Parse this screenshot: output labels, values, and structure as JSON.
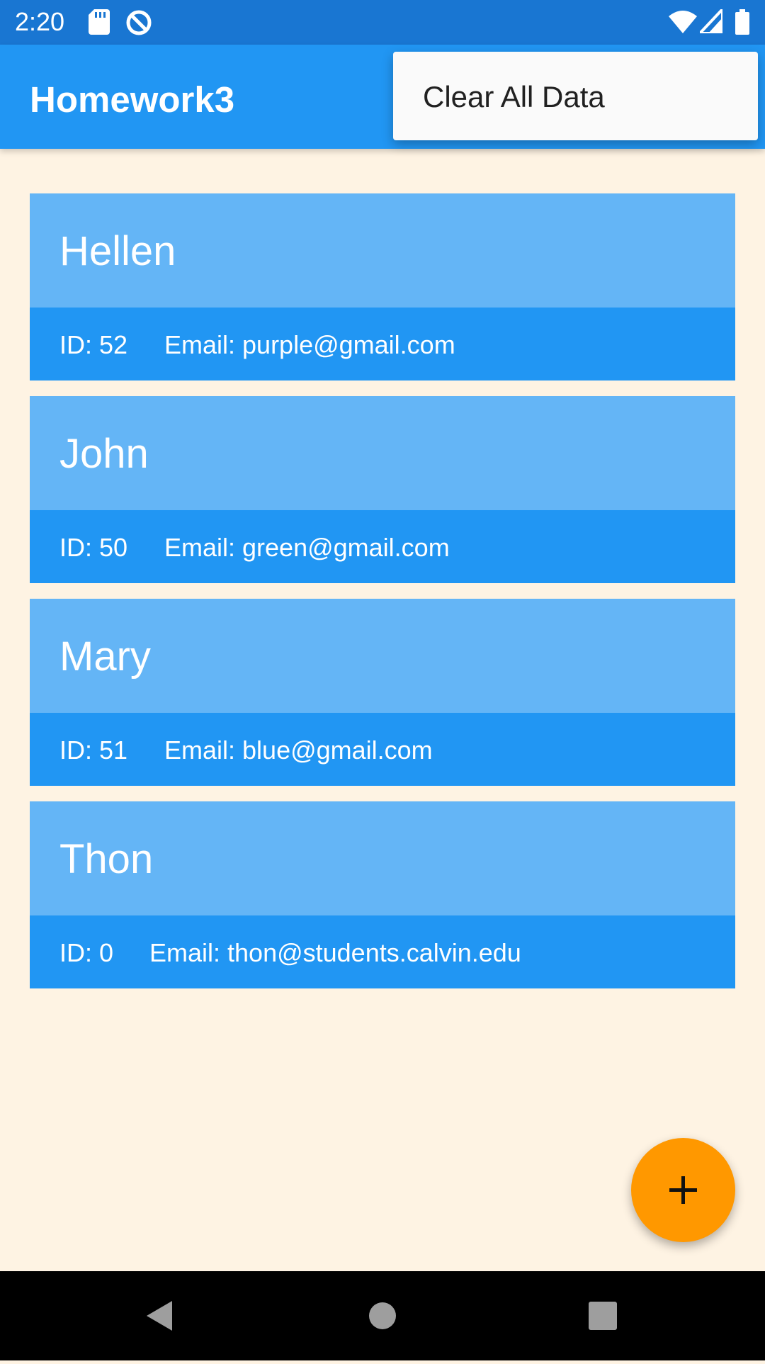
{
  "status_bar": {
    "time": "2:20",
    "left_icons": [
      "sd-card-icon",
      "data-saver-icon"
    ],
    "right_icons": [
      "wifi-icon",
      "cell-signal-icon",
      "battery-icon"
    ]
  },
  "app_bar": {
    "title": "Homework3"
  },
  "overflow_menu": {
    "items": [
      {
        "label": "Clear All Data"
      }
    ]
  },
  "contacts": [
    {
      "name": "Hellen",
      "id_text": "ID: 52",
      "email_text": "Email: purple@gmail.com"
    },
    {
      "name": "John",
      "id_text": "ID: 50",
      "email_text": "Email: green@gmail.com"
    },
    {
      "name": "Mary",
      "id_text": "ID: 51",
      "email_text": "Email: blue@gmail.com"
    },
    {
      "name": "Thon",
      "id_text": "ID: 0",
      "email_text": "Email: thon@students.calvin.edu"
    }
  ],
  "fab": {
    "icon": "plus-icon"
  },
  "nav_bar": {
    "icons": [
      "back-icon",
      "home-icon",
      "recents-icon"
    ]
  },
  "colors": {
    "status_bar": "#1976D2",
    "app_bar": "#2196F3",
    "background": "#FEF3E3",
    "card_header": "#64B5F6",
    "card_footer": "#2196F3",
    "fab": "#FF9800",
    "menu_background": "#FAFAFA"
  }
}
